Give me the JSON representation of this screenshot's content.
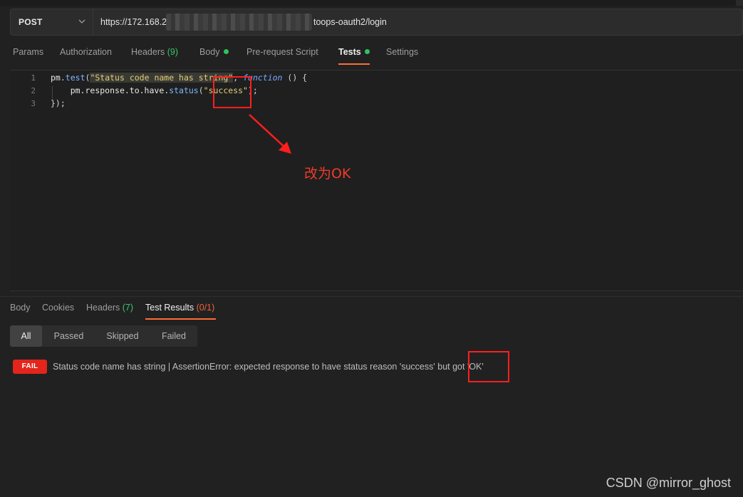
{
  "request": {
    "method": "POST",
    "url_prefix": "https://172.168.2",
    "url_suffix": "toops-oauth2/login"
  },
  "request_tabs": [
    {
      "label": "Params"
    },
    {
      "label": "Authorization"
    },
    {
      "label": "Headers",
      "count": "(9)"
    },
    {
      "label": "Body"
    },
    {
      "label": "Pre-request Script"
    },
    {
      "label": "Tests"
    },
    {
      "label": "Settings"
    }
  ],
  "active_request_tab": "Tests",
  "editor": {
    "line_numbers": [
      "1",
      "2",
      "3"
    ],
    "line1": {
      "a": "pm",
      "b": ".",
      "c": "test",
      "d": "(",
      "e": "\"Status code name has string\"",
      "f": ", ",
      "g": "function",
      "h": " () {"
    },
    "line2": {
      "indent": "    ",
      "a": "pm.response.to.have.",
      "b": "status",
      "c": "(",
      "d": "\"success\"",
      "e": ");"
    },
    "line3": "});"
  },
  "annotation": {
    "text": "改为OK",
    "color": "#ff1e1e"
  },
  "response_tabs": [
    {
      "label": "Body"
    },
    {
      "label": "Cookies"
    },
    {
      "label": "Headers",
      "count": "(7)"
    },
    {
      "label": "Test Results",
      "count": "(0/1)"
    }
  ],
  "filters": [
    "All",
    "Passed",
    "Skipped",
    "Failed"
  ],
  "active_filter": "All",
  "results": [
    {
      "status": "FAIL",
      "message": "Status code name has string | AssertionError: expected response to have status reason 'success' but got 'OK'"
    }
  ],
  "watermark": "CSDN @mirror_ghost",
  "colors": {
    "background": "#212121",
    "accent": "#ff6c37",
    "pass_green": "#2ec35d",
    "fail_red": "#e3251b"
  }
}
